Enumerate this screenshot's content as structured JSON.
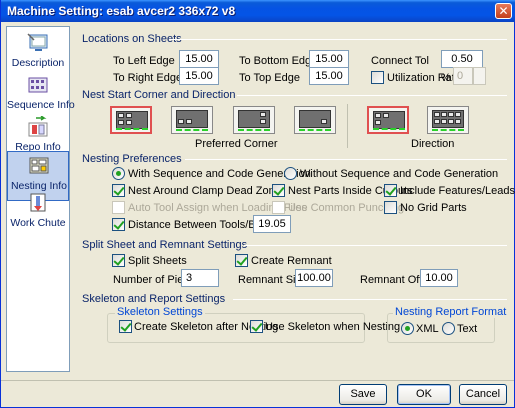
{
  "window": {
    "title_prefix": "Machine Setting:",
    "title_machine": "esab avcer2 336x72 v8",
    "close_glyph": "✕"
  },
  "sidebar": {
    "items": [
      {
        "label": "Description",
        "icon": "description-icon"
      },
      {
        "label": "Sequence Info",
        "icon": "sequence-info-icon"
      },
      {
        "label": "Repo Info",
        "icon": "repo-info-icon"
      },
      {
        "label": "Nesting Info",
        "icon": "nesting-info-icon",
        "selected": true
      },
      {
        "label": "Work Chute",
        "icon": "work-chute-icon"
      }
    ]
  },
  "locations": {
    "header": "Locations on Sheets",
    "to_left_edge": {
      "label": "To Left Edge",
      "value": "15.00"
    },
    "to_right_edge": {
      "label": "To Right Edge",
      "value": "15.00"
    },
    "to_bottom_edge": {
      "label": "To Bottom Edge",
      "value": "15.00"
    },
    "to_top_edge": {
      "label": "To Top Edge",
      "value": "15.00"
    },
    "connect_tol": {
      "label": "Connect Tol",
      "value": "0.50"
    },
    "utilization": {
      "label": "Utilization Ratio",
      "unit": "%",
      "value": "0",
      "checked": false
    }
  },
  "nest_start": {
    "header": "Nest Start Corner and Direction",
    "preferred_corner_label": "Preferred Corner",
    "direction_label": "Direction"
  },
  "nesting_prefs": {
    "header": "Nesting Preferences",
    "with_sequence": "With Sequence and Code Generation",
    "without_sequence": "Without Sequence and Code Generation",
    "nest_around_clamp": "Nest Around Clamp Dead Zone",
    "nest_parts_inside": "Nest Parts Inside Cutouts",
    "include_features": "Include Features/Leads",
    "auto_tool_assign": "Auto Tool Assign when Loading Files",
    "use_common_punching": "Use Common Punching",
    "no_grid_parts": "No Grid Parts",
    "distance_between_tools": "Distance Between Tools/Beam",
    "distance_value": "19.05"
  },
  "split_sheet": {
    "header": "Split Sheet and Remnant Settings",
    "split_sheets": "Split Sheets",
    "create_remnant": "Create Remnant",
    "number_of_pieces_label": "Number of Pieces",
    "number_of_pieces_value": "3",
    "remnant_size_label": "Remnant Size",
    "remnant_size_value": "100.00",
    "remnant_offset_label": "Remnant Offset",
    "remnant_offset_value": "10.00"
  },
  "skeleton": {
    "header": "Skeleton and Report Settings",
    "group_title": "Skeleton Settings",
    "create_skeleton": "Create Skeleton after Nesting",
    "use_skeleton": "Use Skeleton when Nesting",
    "report_group_title": "Nesting Report Format",
    "xml": "XML",
    "text": "Text"
  },
  "buttons": {
    "save": "Save",
    "ok": "OK",
    "cancel": "Cancel"
  },
  "colors": {
    "title_bar": "#0553e4",
    "close_button": "#c3401c",
    "selected_corner": "#e05050",
    "checkmark": "#21a121",
    "group_title": "#0046d5"
  }
}
